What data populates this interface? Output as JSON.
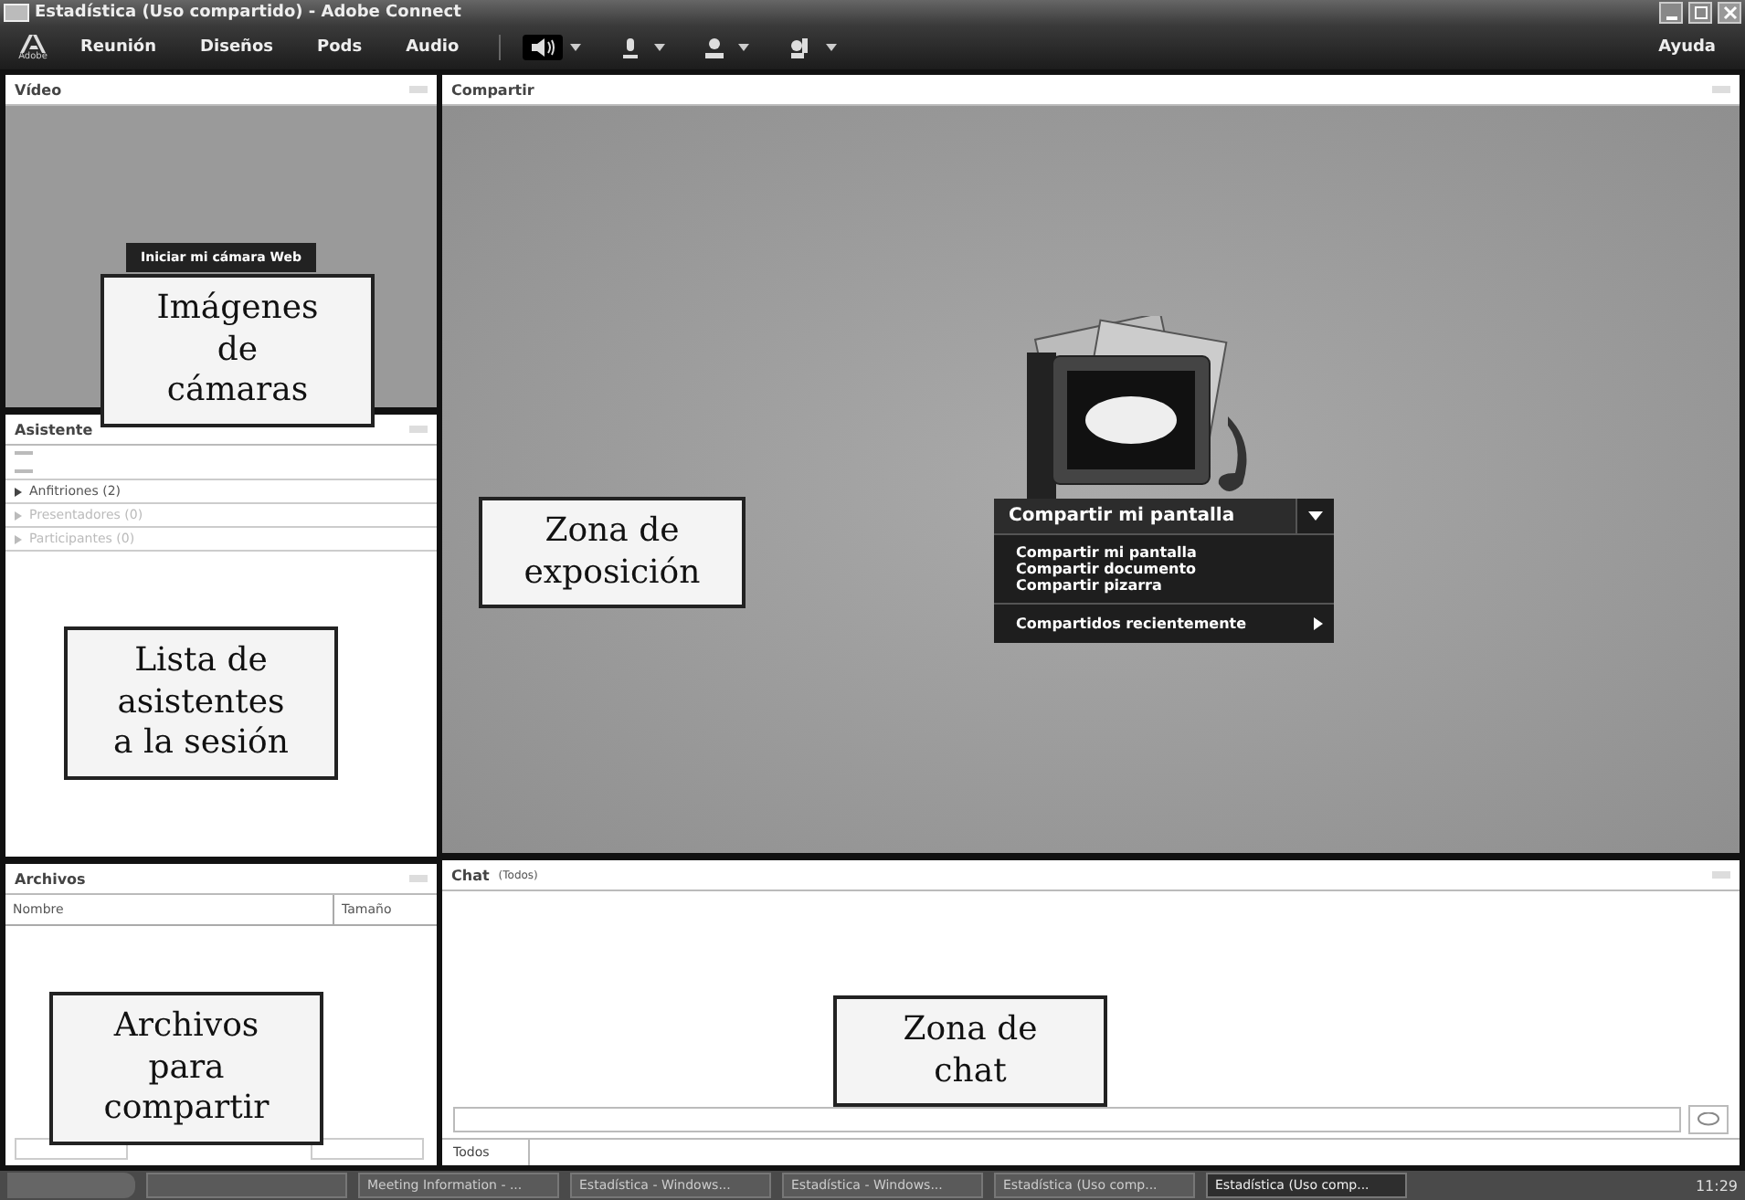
{
  "window": {
    "title": "Estadística (Uso compartido) - Adobe Connect"
  },
  "menu": {
    "logo": "Adobe",
    "items": [
      "Reunión",
      "Diseños",
      "Pods",
      "Audio"
    ],
    "help": "Ayuda",
    "audio_on": true
  },
  "video_pod": {
    "title": "Vídeo",
    "button": "Iniciar mi cámara Web"
  },
  "attendees_pod": {
    "title": "Asistente",
    "groups": [
      {
        "label": "Anfitriones (2)",
        "disabled": false
      },
      {
        "label": "Presentadores (0)",
        "disabled": true
      },
      {
        "label": "Participantes (0)",
        "disabled": true
      }
    ]
  },
  "share_pod": {
    "title": "Compartir",
    "button": "Compartir mi pantalla",
    "menu": [
      "Compartir mi pantalla",
      "Compartir documento",
      "Compartir pizarra"
    ],
    "recent": "Compartidos recientemente"
  },
  "files_pod": {
    "title": "Archivos",
    "columns": [
      "Nombre",
      "Tamaño"
    ]
  },
  "chat_pod": {
    "title": "Chat",
    "scope": "(Todos)",
    "tab": "Todos"
  },
  "taskbar": {
    "items": [
      {
        "label": "Meeting Information - ...",
        "selected": false
      },
      {
        "label": "Estadística - Windows...",
        "selected": false
      },
      {
        "label": "Estadística - Windows...",
        "selected": false
      },
      {
        "label": "Estadística (Uso comp...",
        "selected": false
      },
      {
        "label": "Estadística (Uso comp...",
        "selected": true
      }
    ],
    "clock": "11:29"
  },
  "callouts": [
    "Imágenes\nde\ncámaras",
    "Zona de\nexposición",
    "Lista de\nasistentes\na la sesión",
    "Archivos\npara\ncompartir",
    "Zona de\nchat"
  ]
}
